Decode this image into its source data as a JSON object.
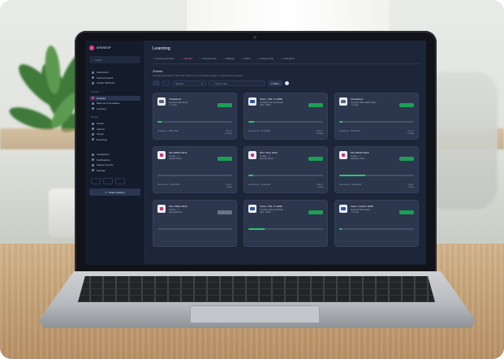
{
  "app": {
    "brand": "SENSEOP",
    "page_title": "Learning",
    "search_placeholder": "Search",
    "accent": "#e2457a",
    "success": "#1e9e57"
  },
  "sidebar": {
    "groups": [
      {
        "label": "",
        "items": [
          {
            "label": "Dashboard",
            "icon": "home-icon",
            "active": false
          },
          {
            "label": "Shared Folders",
            "icon": "folder-icon",
            "active": false
          },
          {
            "label": "Create Playbook",
            "icon": "plus-icon",
            "active": false
          }
        ]
      },
      {
        "label": "Activities",
        "items": [
          {
            "label": "Courses",
            "icon": "book-icon",
            "active": true
          },
          {
            "label": "Base Kit & Templates",
            "icon": "kit-icon",
            "active": false
          },
          {
            "label": "Learning",
            "icon": "graduation-icon",
            "active": false
          }
        ]
      },
      {
        "label": "Manage",
        "items": [
          {
            "label": "Teams",
            "icon": "team-icon",
            "active": false
          },
          {
            "label": "Admins",
            "icon": "admin-icon",
            "active": false
          },
          {
            "label": "Virtual",
            "icon": "monitor-icon",
            "active": false
          },
          {
            "label": "Reporting",
            "icon": "chart-icon",
            "active": false
          }
        ]
      }
    ],
    "bottom_items": [
      {
        "label": "Integrations",
        "icon": "plug-icon"
      },
      {
        "label": "Notifications",
        "icon": "bell-icon"
      },
      {
        "label": "Support Centre",
        "icon": "help-icon"
      },
      {
        "label": "Settings",
        "icon": "gear-icon"
      }
    ],
    "button_label": "Share Session"
  },
  "tabs": [
    {
      "label": "Learning Journeys",
      "active": false
    },
    {
      "label": "All Labs",
      "active": true
    },
    {
      "label": "Assessments",
      "active": false
    },
    {
      "label": "Manage",
      "active": false
    },
    {
      "label": "Paths",
      "active": false
    },
    {
      "label": "Assignments",
      "active": false
    },
    {
      "label": "Collections",
      "active": false
    }
  ],
  "content": {
    "count_label": "30 items",
    "hint": "Use filters and search to find a lab. Select one to view details, assign it, or track learner progress.",
    "sort_label": "Newest",
    "search_placeholder": "Search labs",
    "filter_label": "Filter"
  },
  "cards": [
    {
      "title": "Cheatsheet",
      "sub": [
        "Keycloak SSO Setup",
        "+ 4 more"
      ],
      "icon": "document-icon",
      "icon_style": "gray",
      "status": "done",
      "progress": 0.05,
      "foot_left": "Created by · 20/11/2023",
      "foot_right": [
        "Time in",
        "1.5 days"
      ]
    },
    {
      "title": "Token | SSL 17.2008",
      "sub": [
        "Configure SSL Cert/Chain",
        "Labs · 2008"
      ],
      "icon": "token-icon",
      "icon_style": "blue",
      "status": "done",
      "progress": 0.08,
      "foot_left": "Launched at · 20/11/2023",
      "foot_right": [
        "Time in",
        "1.5 days"
      ]
    },
    {
      "title": "Cheatsheet",
      "sub": [
        "Keycloak SSO Realm Setup",
        "+ 3 more"
      ],
      "icon": "document-icon",
      "icon_style": "gray",
      "status": "done",
      "progress": 0.04,
      "foot_left": "Created by · 20/11/2023",
      "foot_right": [
        "Time in",
        "1.5 days"
      ]
    },
    {
      "title": "Plus 98421-0271",
      "sub": [
        "Threats · 1",
        "Identity Admin"
      ],
      "icon": "lab-icon",
      "icon_style": "pink",
      "status": "done",
      "progress": 0.0,
      "foot_left": "Launched at · 19/11/2023",
      "foot_right": [
        "Time in",
        "2 days"
      ]
    },
    {
      "title": "Plus 79mn 2024",
      "sub": [
        "Threats · 1",
        "Security Admin"
      ],
      "icon": "lab-icon",
      "icon_style": "pink",
      "status": "done",
      "progress": 0.06,
      "foot_left": "Launched at · 19/11/2023",
      "foot_right": [
        "Time in",
        "2 days"
      ]
    },
    {
      "title": "Plus 89105 2023",
      "sub": [
        "Threats · 1",
        "Hardware Team"
      ],
      "icon": "lab-icon",
      "icon_style": "pink",
      "status": "done",
      "progress": 0.35,
      "foot_left": "Launched at · 18/11/2023",
      "foot_right": [
        "Time in",
        "2 days"
      ]
    },
    {
      "title": "Plus 79101 2023",
      "sub": [
        "Threats · 1",
        "Setup planned"
      ],
      "icon": "lab-icon",
      "icon_style": "pink",
      "status": "pending",
      "progress": 0.0,
      "foot_left": "",
      "foot_right": [
        "",
        ""
      ]
    },
    {
      "title": "Token | SSL 17.2009",
      "sub": [
        "Configure SSL Cert/Chain",
        "Labs · 2009"
      ],
      "icon": "token-icon",
      "icon_style": "blue",
      "status": "done",
      "progress": 0.22,
      "foot_left": "",
      "foot_right": [
        "",
        ""
      ]
    },
    {
      "title": "Token | FACET 2008",
      "sub": [
        "Keycloak SSO Realm",
        "+ 2 more"
      ],
      "icon": "token-icon",
      "icon_style": "blue",
      "status": "done",
      "progress": 0.03,
      "foot_left": "",
      "foot_right": [
        "",
        ""
      ]
    }
  ]
}
